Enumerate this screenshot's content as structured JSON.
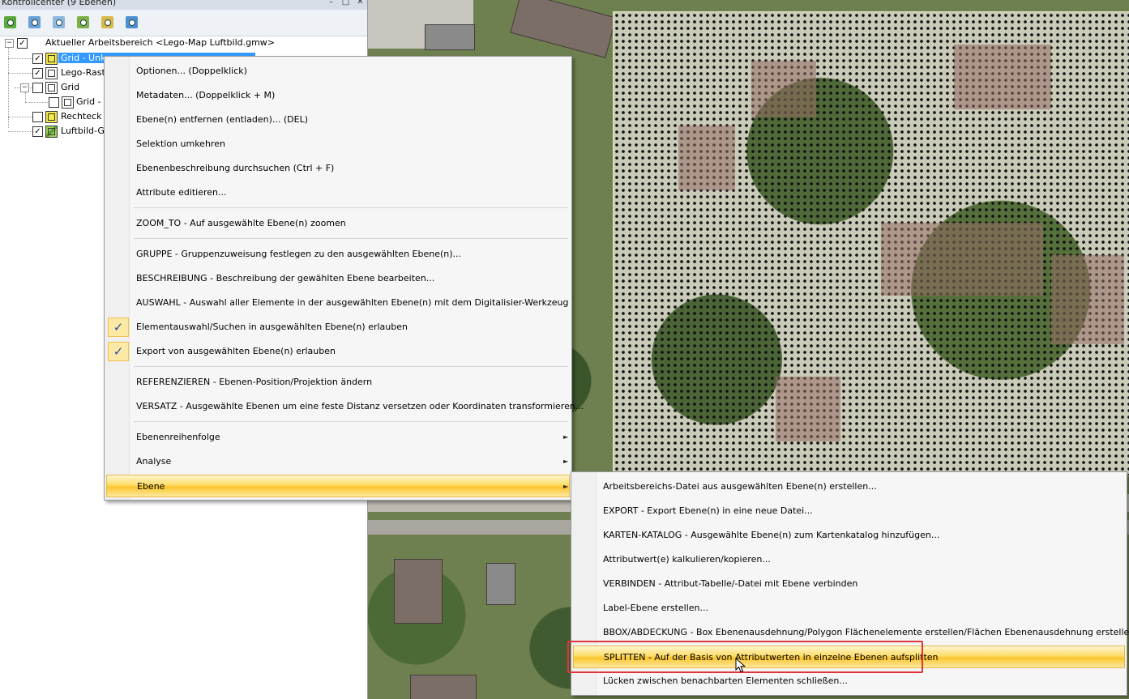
{
  "panel": {
    "title": "Kontrollcenter (9 Ebenen)",
    "window_buttons": [
      "–",
      "□",
      "✕"
    ],
    "toolbar": [
      {
        "icon": "zoom-layer-icon",
        "color": "#5ba83a"
      },
      {
        "icon": "layer-list-icon",
        "color": "#6aa0d8"
      },
      {
        "icon": "remove-layer-icon",
        "color": "#8cb8e0"
      },
      {
        "icon": "layer-group-icon",
        "color": "#7ab046"
      },
      {
        "icon": "layer-search-icon",
        "color": "#d9b84a"
      },
      {
        "icon": "visibility-eye-icon",
        "color": "#4d8fcf"
      }
    ]
  },
  "tree": {
    "workspace": "Aktueller Arbeitsbereich <Lego-Map Luftbild.gmw>",
    "layers": [
      {
        "label": "Grid - Unk",
        "checked": true,
        "selected": true
      },
      {
        "label": "Lego-Rast",
        "checked": true
      },
      {
        "label": "Grid",
        "checked": false
      },
      {
        "label": "Grid - (",
        "checked": false
      },
      {
        "label": "Rechteck [",
        "checked": false
      },
      {
        "label": "Luftbild-G",
        "checked": true
      }
    ]
  },
  "context_menu": {
    "items": [
      "Optionen... (Doppelklick)",
      "Metadaten... (Doppelklick + M)",
      "Ebene(n) entfernen (entladen)... (DEL)",
      "Selektion umkehren",
      "Ebenenbeschreibung durchsuchen (Ctrl + F)",
      "Attribute editieren...",
      "ZOOM_TO - Auf ausgewählte Ebene(n) zoomen",
      "GRUPPE - Gruppenzuweisung festlegen zu den ausgewählten Ebene(n)...",
      "BESCHREIBUNG - Beschreibung der gewählten Ebene bearbeiten...",
      "AUSWAHL - Auswahl aller Elemente in der ausgewählten Ebene(n) mit dem Digitalisier-Werkzeug",
      "Elementauswahl/Suchen in ausgewählten Ebene(n) erlauben",
      "Export von ausgewählten Ebene(n) erlauben",
      "REFERENZIEREN - Ebenen-Position/Projektion ändern",
      "VERSATZ - Ausgewählte Ebenen um eine feste Distanz versetzen oder Koordinaten transformieren...",
      "Ebenenreihenfolge",
      "Analyse",
      "Ebene"
    ],
    "check_mark": "✓",
    "submenu_arrow": "►"
  },
  "submenu": {
    "items": [
      "Arbeitsbereichs-Datei aus ausgewählten Ebene(n) erstellen...",
      "EXPORT - Export Ebene(n) in eine neue Datei...",
      "KARTEN-KATALOG - Ausgewählte Ebene(n) zum Kartenkatalog hinzufügen...",
      "Attributwert(e) kalkulieren/kopieren...",
      "VERBINDEN - Attribut-Tabelle/-Datei mit Ebene verbinden",
      "Label-Ebene erstellen...",
      "BBOX/ABDECKUNG - Box Ebenenausdehnung/Polygon Flächenelemente erstellen/Flächen Ebenenausdehnung erstellen",
      "SPLITTEN - Auf der Basis von Attributwerten in einzelne Ebenen aufsplitten",
      "Lücken zwischen benachbarten Elementen schließen..."
    ],
    "highlight_color": "#e0343c"
  }
}
